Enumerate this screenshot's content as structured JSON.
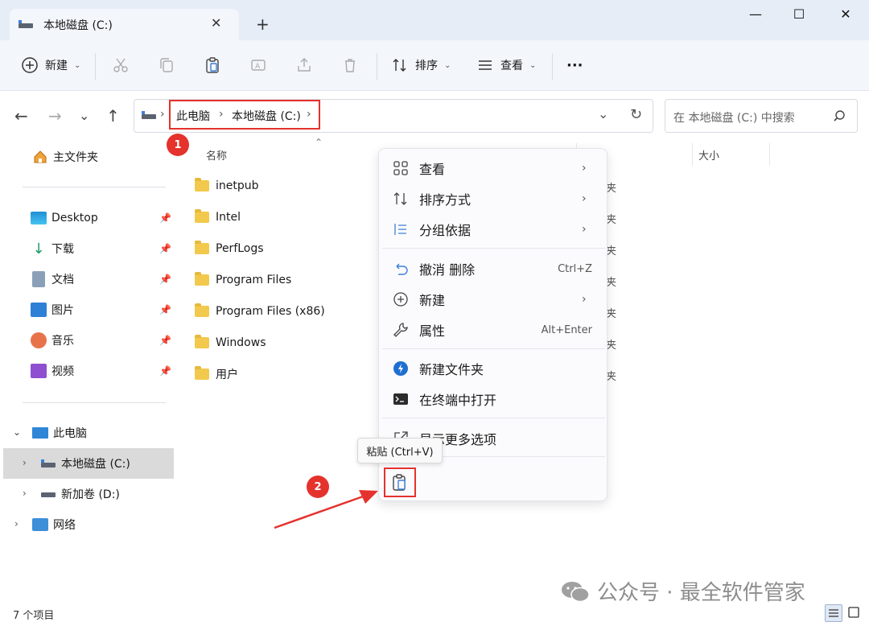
{
  "window": {
    "tab_title": "本地磁盘 (C:)",
    "close_tab": "✕",
    "new_tab": "+",
    "minimize": "—",
    "maximize": "☐",
    "close": "✕"
  },
  "toolbar": {
    "new_label": "新建",
    "sort_label": "排序",
    "view_label": "查看",
    "more_label": "···"
  },
  "address": {
    "crumbs": [
      "此电脑",
      "本地磁盘 (C:)"
    ],
    "sep": "›",
    "search_placeholder": "在 本地磁盘 (C:) 中搜索"
  },
  "sidebar": {
    "home": "主文件夹",
    "quick": [
      {
        "label": "Desktop",
        "icon": "desktop-icon"
      },
      {
        "label": "下载",
        "icon": "download-icon"
      },
      {
        "label": "文档",
        "icon": "document-icon"
      },
      {
        "label": "图片",
        "icon": "picture-icon"
      },
      {
        "label": "音乐",
        "icon": "music-icon"
      },
      {
        "label": "视频",
        "icon": "video-icon"
      }
    ],
    "this_pc": "此电脑",
    "drive_c": "本地磁盘 (C:)",
    "drive_d": "新加卷 (D:)",
    "network": "网络"
  },
  "columns": {
    "name": "名称",
    "size": "大小"
  },
  "files": [
    "inetpub",
    "Intel",
    "PerfLogs",
    "Program Files",
    "Program Files (x86)",
    "Windows",
    "用户"
  ],
  "type_fragment": "夹",
  "context_menu": {
    "view": "查看",
    "sort": "排序方式",
    "group": "分组依据",
    "undo": "撤消 删除",
    "undo_shortcut": "Ctrl+Z",
    "new": "新建",
    "properties": "属性",
    "properties_shortcut": "Alt+Enter",
    "new_folder": "新建文件夹",
    "terminal": "在终端中打开",
    "more_options": "显示更多选项"
  },
  "tooltip": "粘贴 (Ctrl+V)",
  "badges": {
    "one": "1",
    "two": "2"
  },
  "status": {
    "item_count": "7 个项目"
  },
  "watermark": "公众号 · 最全软件管家",
  "colors": {
    "accent_red": "#e5322d",
    "folder": "#f2c94c",
    "titlebar": "#e6edf6"
  }
}
